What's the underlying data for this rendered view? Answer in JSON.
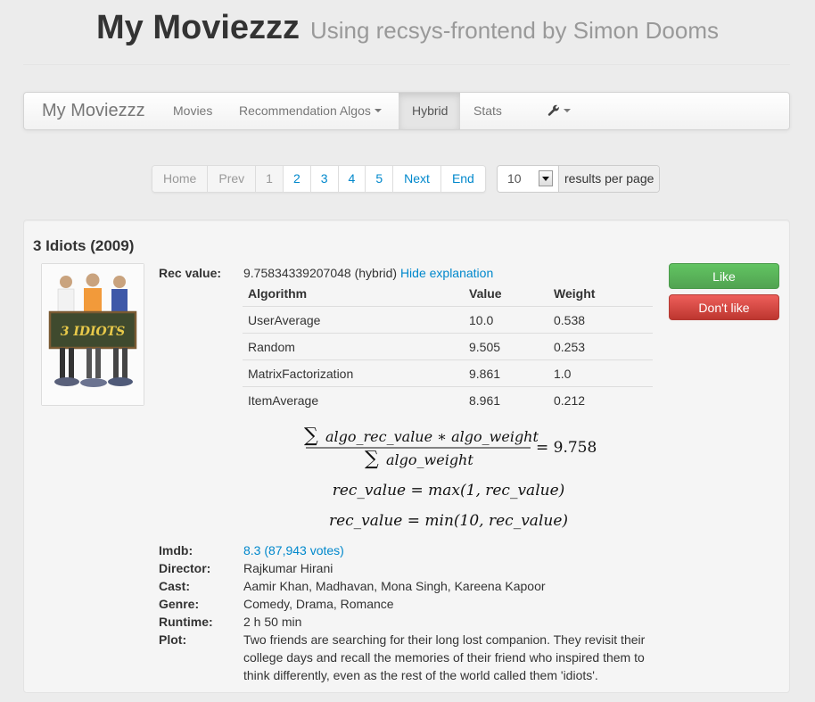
{
  "header": {
    "title": "My Moviezzz",
    "subtitle": "Using recsys-frontend by Simon Dooms"
  },
  "navbar": {
    "brand": "My Moviezzz",
    "items": [
      {
        "label": "Movies"
      },
      {
        "label": "Recommendation Algos",
        "dropdown": true
      },
      {
        "label": "Hybrid",
        "active": true
      },
      {
        "label": "Stats"
      }
    ],
    "tools_icon": "wrench-icon"
  },
  "pagination": {
    "home": "Home",
    "prev": "Prev",
    "pages": [
      "1",
      "2",
      "3",
      "4",
      "5"
    ],
    "current_page": "1",
    "next": "Next",
    "end": "End",
    "per_page_value": "10",
    "per_page_suffix": "results per page"
  },
  "movie": {
    "title": "3 Idiots (2009)",
    "poster_text": "3 IDIOTS",
    "rec_label": "Rec value:",
    "rec_value": "9.75834339207048",
    "rec_method": "(hybrid)",
    "hide_explanation": "Hide explanation",
    "table": {
      "headers": [
        "Algorithm",
        "Value",
        "Weight"
      ],
      "rows": [
        [
          "UserAverage",
          "10.0",
          "0.538"
        ],
        [
          "Random",
          "9.505",
          "0.253"
        ],
        [
          "MatrixFactorization",
          "9.861",
          "1.0"
        ],
        [
          "ItemAverage",
          "8.961",
          "0.212"
        ]
      ]
    },
    "formula": {
      "numerator": "algo_rec_value ∗ algo_weight",
      "denominator": "algo_weight",
      "result": "= 9.758",
      "line2": "rec_value = max(1, rec_value)",
      "line3": "rec_value = min(10, rec_value)"
    },
    "buttons": {
      "like": "Like",
      "dislike": "Don't like"
    },
    "details": {
      "imdb_label": "Imdb:",
      "imdb_value": "8.3 (87,943 votes)",
      "director_label": "Director:",
      "director_value": "Rajkumar Hirani",
      "cast_label": "Cast:",
      "cast_value": "Aamir Khan, Madhavan, Mona Singh, Kareena Kapoor",
      "genre_label": "Genre:",
      "genre_value": "Comedy, Drama, Romance",
      "runtime_label": "Runtime:",
      "runtime_value": "2 h 50 min",
      "plot_label": "Plot:",
      "plot_value": "Two friends are searching for their long lost companion. They revisit their college days and recall the memories of their friend who inspired them to think differently, even as the rest of the world called them 'idiots'."
    }
  },
  "colors": {
    "link": "#0088cc",
    "like": "#51a351",
    "dislike": "#bd362f"
  }
}
